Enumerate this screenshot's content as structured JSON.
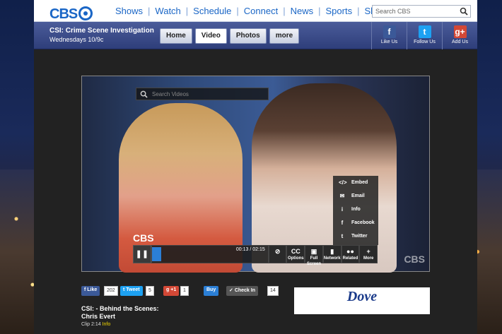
{
  "site": {
    "logo": "CBS",
    "nav": [
      "Shows",
      "Watch",
      "Schedule",
      "Connect",
      "News",
      "Sports",
      "Shop"
    ],
    "search_placeholder": "Search CBS"
  },
  "show": {
    "title": "CSI: Crime Scene Investigation",
    "schedule": "Wednesdays 10/9c",
    "tabs": [
      "Home",
      "Video",
      "Photos",
      "more"
    ],
    "active_tab": "Video",
    "social": [
      {
        "label": "Like Us",
        "icon": "facebook-icon",
        "color": "#3b5998",
        "glyph": "f"
      },
      {
        "label": "Follow Us",
        "icon": "twitter-icon",
        "color": "#1da1f2",
        "glyph": "t"
      },
      {
        "label": "Add Us",
        "icon": "google-plus-icon",
        "color": "#d34836",
        "glyph": "g+"
      }
    ]
  },
  "player": {
    "search_placeholder": "Search Videos",
    "logo": "CBS",
    "time": "00:13 / 02:15",
    "progress_fraction": 0.08,
    "share_menu": [
      {
        "label": "Embed",
        "icon": "embed-icon",
        "glyph": "</>"
      },
      {
        "label": "Email",
        "icon": "email-icon",
        "glyph": "✉"
      },
      {
        "label": "Info",
        "icon": "info-icon",
        "glyph": "i"
      },
      {
        "label": "Facebook",
        "icon": "facebook-icon",
        "glyph": "f"
      },
      {
        "label": "Twitter",
        "icon": "twitter-icon",
        "glyph": "t"
      }
    ],
    "controls": [
      {
        "label": "",
        "glyph": "⊘",
        "name": "no-icon"
      },
      {
        "label": "Options",
        "glyph": "CC",
        "name": "cc-button"
      },
      {
        "label": "Full Screen",
        "glyph": "▣",
        "name": "fullscreen-button"
      },
      {
        "label": "Network",
        "glyph": "▮",
        "name": "network-button"
      },
      {
        "label": "Related",
        "glyph": "●●",
        "name": "related-button"
      },
      {
        "label": "More",
        "glyph": "+",
        "name": "more-button"
      }
    ]
  },
  "sharebar": {
    "like_label": "Like",
    "like_count": "202",
    "tweet_label": "Tweet",
    "tweet_count": "5",
    "gplus_label": "+1",
    "gplus_count": "1",
    "buy_label": "Buy",
    "checkin_label": "Check In",
    "checkin_count": "14"
  },
  "clip": {
    "title_line1": "CSI: - Behind the Scenes:",
    "title_line2": "Chris Evert",
    "meta": "Clip 2:14",
    "info_link": "Info"
  },
  "ad": {
    "brand": "Dove"
  }
}
